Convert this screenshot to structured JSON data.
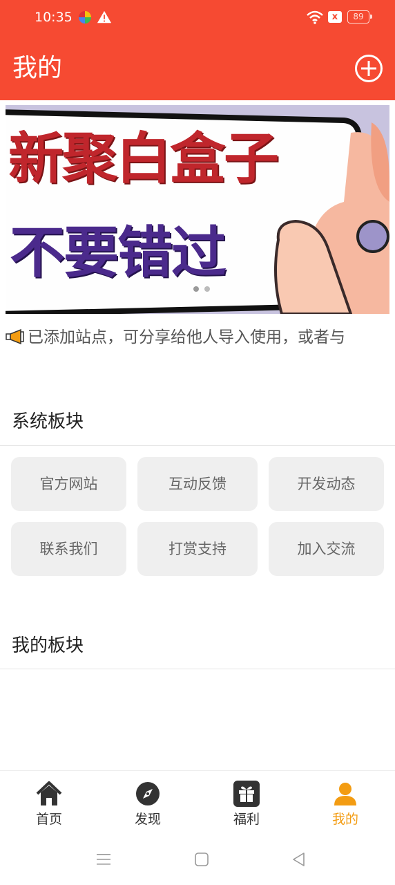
{
  "status_bar": {
    "time": "10:35",
    "battery": "89",
    "sim_icon": "x"
  },
  "header": {
    "title": "我的",
    "add_icon": "plus-circle-icon"
  },
  "banner": {
    "line1": "新聚白盒子",
    "line2": "不要错过",
    "page_count": 2,
    "active_page": 1
  },
  "notice": {
    "text": "已添加站点，可分享给他人导入使用，或者与"
  },
  "system_section": {
    "title": "系统板块",
    "buttons": [
      "官方网站",
      "互动反馈",
      "开发动态",
      "联系我们",
      "打赏支持",
      "加入交流"
    ]
  },
  "my_section": {
    "title": "我的板块"
  },
  "bottom_nav": {
    "items": [
      {
        "label": "首页",
        "icon": "home-icon"
      },
      {
        "label": "发现",
        "icon": "compass-icon"
      },
      {
        "label": "福利",
        "icon": "gift-icon"
      },
      {
        "label": "我的",
        "icon": "user-icon"
      }
    ],
    "active_index": 3
  },
  "colors": {
    "header_bg": "#f64a32",
    "active_tab": "#f39c12",
    "button_bg": "#efefef"
  }
}
